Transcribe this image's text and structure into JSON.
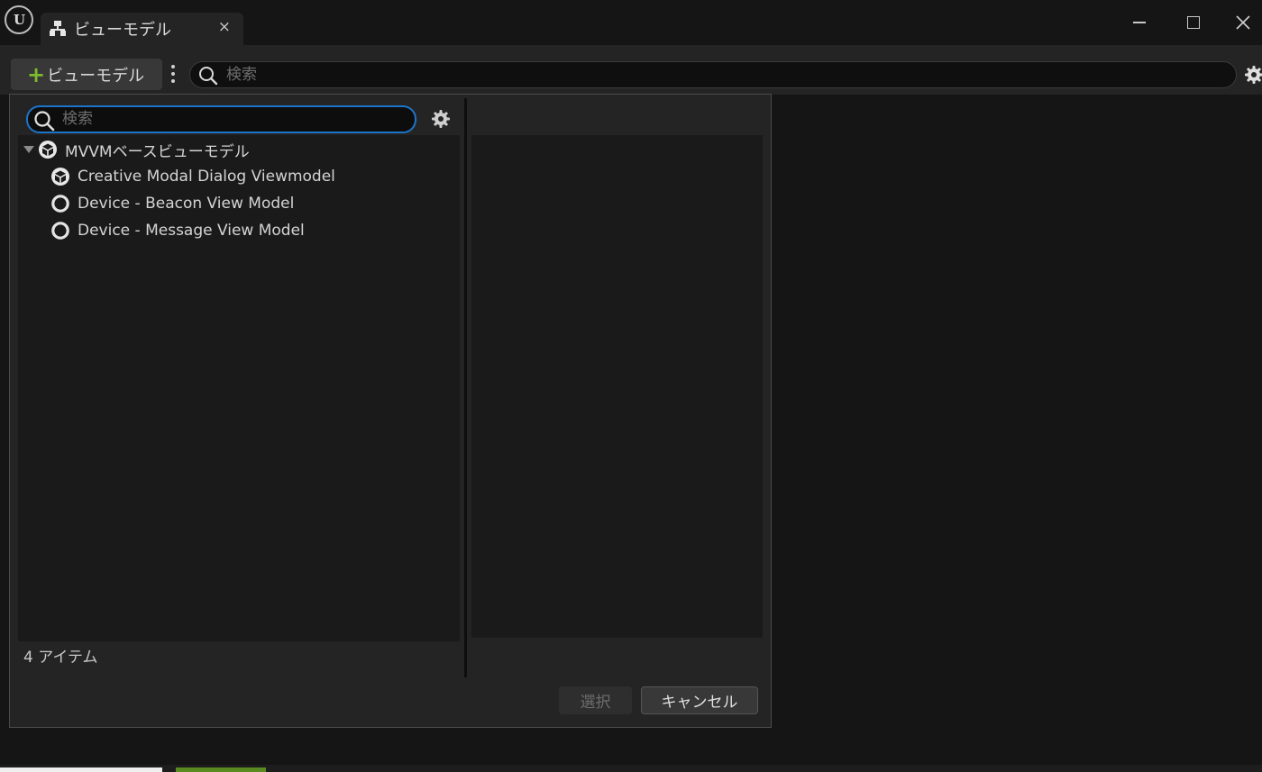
{
  "window": {
    "tab_label": "ビューモデル",
    "tab_close": "×",
    "logo_text": "U"
  },
  "toolbar": {
    "add_button_plus": "+",
    "add_button_label": "ビューモデル",
    "search_placeholder": "検索"
  },
  "dialog": {
    "search_placeholder": "検索",
    "tree": [
      {
        "label": "MVVMベースビューモデル",
        "icon": "cube-icon",
        "expanded": true
      },
      {
        "label": "Creative Modal Dialog Viewmodel",
        "icon": "cube-icon"
      },
      {
        "label": "Device - Beacon View Model",
        "icon": "circle-icon"
      },
      {
        "label": "Device - Message View Model",
        "icon": "circle-icon"
      }
    ],
    "item_count": "4 アイテム",
    "select_label": "選択",
    "cancel_label": "キャンセル"
  },
  "colors": {
    "accent_green": "#7dbb2e",
    "focus_blue": "#1d74c8",
    "background": "#151515",
    "panel": "#242424"
  }
}
